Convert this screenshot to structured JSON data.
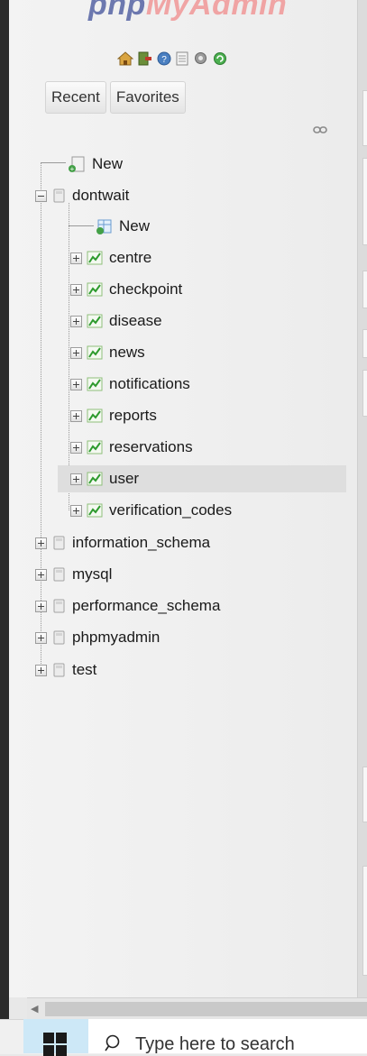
{
  "logo": {
    "part1": "php",
    "part2": "MyAdmin"
  },
  "toolbar_icons": [
    "home-icon",
    "exit-icon",
    "help-icon",
    "docs-icon",
    "settings-icon",
    "reload-icon"
  ],
  "tabs": {
    "recent": "Recent",
    "favorites": "Favorites"
  },
  "tree": {
    "root_new": "New",
    "dontwait": {
      "name": "dontwait",
      "new": "New",
      "tables": [
        "centre",
        "checkpoint",
        "disease",
        "news",
        "notifications",
        "reports",
        "reservations",
        "user",
        "verification_codes"
      ]
    },
    "databases": [
      "information_schema",
      "mysql",
      "performance_schema",
      "phpmyadmin",
      "test"
    ]
  },
  "selected_table": "user",
  "taskbar": {
    "search_placeholder": "Type here to search"
  },
  "colors": {
    "logo_php": "#6c78af",
    "logo_myadmin": "#f0a4a4",
    "table_icon": "#3aa33a",
    "start_button": "#cde8f7"
  }
}
